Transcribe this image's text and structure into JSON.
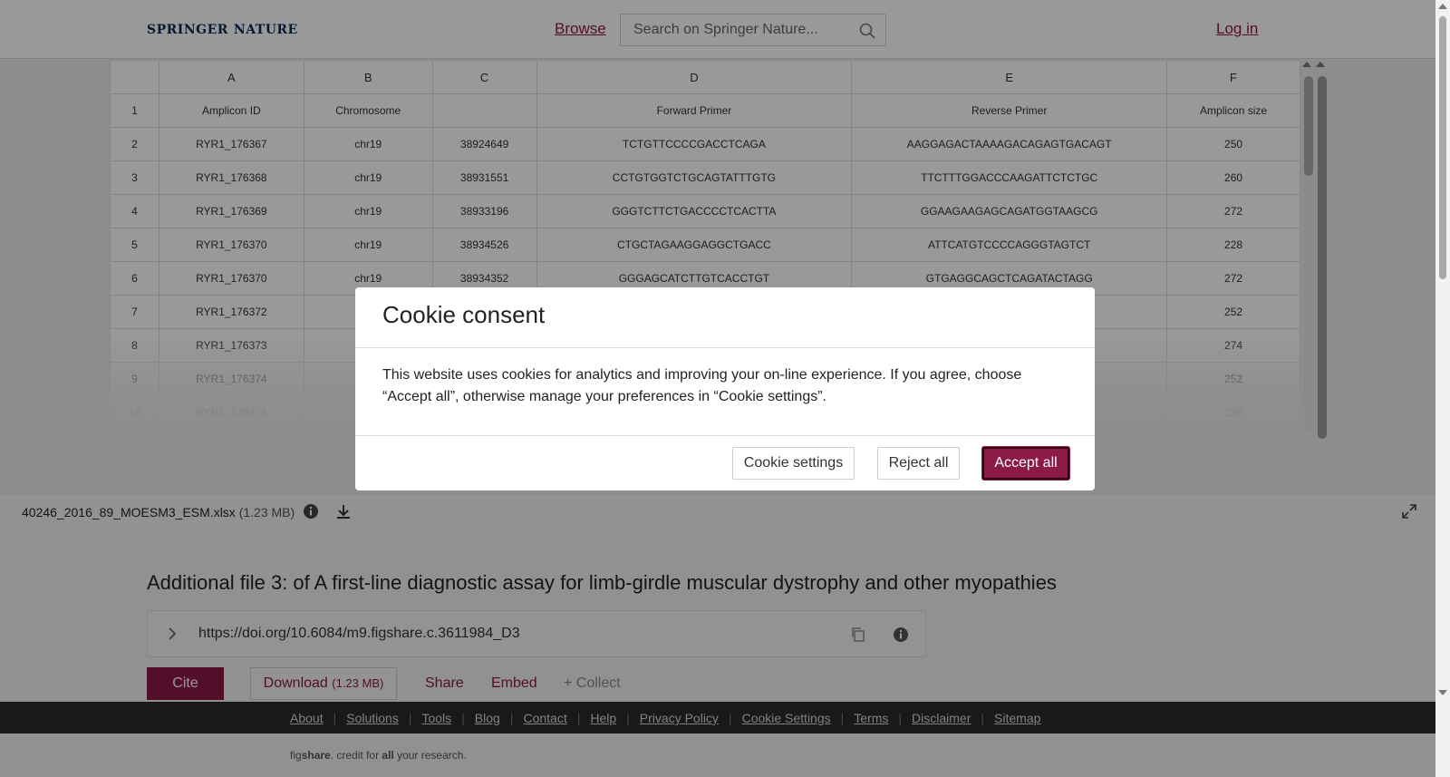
{
  "header": {
    "logo_springer": "Springer",
    "logo_nature": "Nature",
    "browse": "Browse",
    "search_placeholder": "Search on Springer Nature...",
    "login": "Log in"
  },
  "sheet": {
    "columns": [
      "",
      "A",
      "B",
      "C",
      "D",
      "E",
      "F"
    ],
    "rows": [
      [
        "1",
        "Amplicon ID",
        "Chromosome",
        "",
        "Forward Primer",
        "Reverse Primer",
        "Amplicon size"
      ],
      [
        "2",
        "RYR1_176367",
        "chr19",
        "38924649",
        "TCTGTTCCCCGACCTCAGA",
        "AAGGAGACTAAAAGACAGAGTGACAGT",
        "250"
      ],
      [
        "3",
        "RYR1_176368",
        "chr19",
        "38931551",
        "CCTGTGGTCTGCAGTATTTGTG",
        "TTCTTTGGACCCAAGATTCTCTGC",
        "260"
      ],
      [
        "4",
        "RYR1_176369",
        "chr19",
        "38933196",
        "GGGTCTTCTGACCCCTCACTTA",
        "GGAAGAAGAGCAGATGGTAAGCG",
        "272"
      ],
      [
        "5",
        "RYR1_176370",
        "chr19",
        "38934526",
        "CTGCTAGAAGGAGGCTGACC",
        "ATTCATGTCCCCAGGGTAGTCT",
        "228"
      ],
      [
        "6",
        "RYR1_176370",
        "chr19",
        "38934352",
        "GGGAGCATCTTGTCACCTGT",
        "GTGAGGCAGCTCAGATACTAGG",
        "272"
      ],
      [
        "7",
        "RYR1_176372",
        "",
        "",
        "",
        "",
        "252"
      ],
      [
        "8",
        "RYR1_176373",
        "",
        "",
        "",
        "",
        "274"
      ],
      [
        "9",
        "RYR1_176374",
        "",
        "",
        "",
        "",
        "252"
      ],
      [
        "10",
        "RYR1_176376",
        "",
        "",
        "",
        "",
        "226"
      ]
    ]
  },
  "file": {
    "name": "40246_2016_89_MOESM3_ESM.xlsx",
    "size": "(1.23 MB)"
  },
  "item": {
    "title": "Additional file 3: of A first-line diagnostic assay for limb-girdle muscular dystrophy and other myopathies",
    "doi": "https://doi.org/10.6084/m9.figshare.c.3611984_D3",
    "cite": "Cite",
    "download": "Download",
    "download_size": "(1.23 MB)",
    "share": "Share",
    "embed": "Embed",
    "collect": "+ Collect"
  },
  "footer": {
    "links": [
      "About",
      "Solutions",
      "Tools",
      "Blog",
      "Contact",
      "Help",
      "Privacy Policy",
      "Cookie Settings",
      "Terms",
      "Disclaimer",
      "Sitemap"
    ],
    "tag_fig": "fig",
    "tag_share": "share",
    "tag_mid": ". credit for ",
    "tag_all": "all",
    "tag_end": " your research."
  },
  "cookie": {
    "title": "Cookie consent",
    "body": "This website uses cookies for analytics and improving your on-line experience. If you agree, choose “Accept all”, otherwise manage your preferences in “Cookie settings”.",
    "settings": "Cookie settings",
    "reject": "Reject all",
    "accept": "Accept all"
  },
  "colors": {
    "brand": "#8b1a46",
    "logo": "#0b2a55",
    "footer_bg": "#2b2b2b"
  }
}
